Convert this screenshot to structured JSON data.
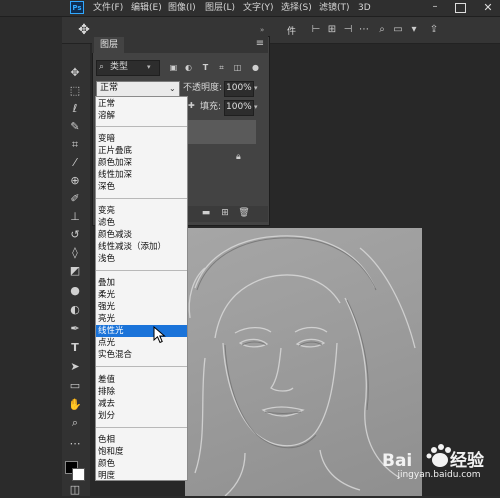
{
  "menu": {
    "items": [
      "文件(F)",
      "编辑(E)",
      "图像(I)",
      "图层(L)",
      "文字(Y)",
      "选择(S)",
      "滤镜(T)",
      "3D"
    ]
  },
  "options_bar": {
    "label_partial": "件"
  },
  "layers_panel": {
    "tab_label": "图层",
    "filter_label": "类型",
    "blend_mode_value": "正常",
    "opacity_label": "不透明度:",
    "opacity_value": "100%",
    "fill_label": "填充:",
    "fill_value": "100%"
  },
  "blend_modes": {
    "groups": [
      [
        "正常",
        "溶解"
      ],
      [
        "变暗",
        "正片叠底",
        "颜色加深",
        "线性加深",
        "深色"
      ],
      [
        "变亮",
        "滤色",
        "颜色减淡",
        "线性减淡（添加）",
        "浅色"
      ],
      [
        "叠加",
        "柔光",
        "强光",
        "亮光",
        "线性光",
        "点光",
        "实色混合"
      ],
      [
        "差值",
        "排除",
        "减去",
        "划分"
      ],
      [
        "色相",
        "饱和度",
        "颜色",
        "明度"
      ]
    ],
    "selected": "线性光"
  },
  "watermark": {
    "text": "jingyan.baidu.com",
    "brand_suffix": "经验"
  },
  "colors": {
    "accent_selected": "#1a73d9",
    "panel_bg": "#434343",
    "app_bg": "#2b2b2b"
  },
  "icons": {
    "toolbar": [
      "move-icon",
      "marquee-icon",
      "lasso-icon",
      "quick-select-icon",
      "crop-icon",
      "eyedropper-icon",
      "healing-icon",
      "brush-icon",
      "stamp-icon",
      "history-brush-icon",
      "eraser-icon",
      "bucket-icon",
      "blur-icon",
      "dodge-icon",
      "pen-icon",
      "type-icon",
      "path-select-icon",
      "rectangle-icon",
      "hand-icon",
      "zoom-icon"
    ]
  }
}
